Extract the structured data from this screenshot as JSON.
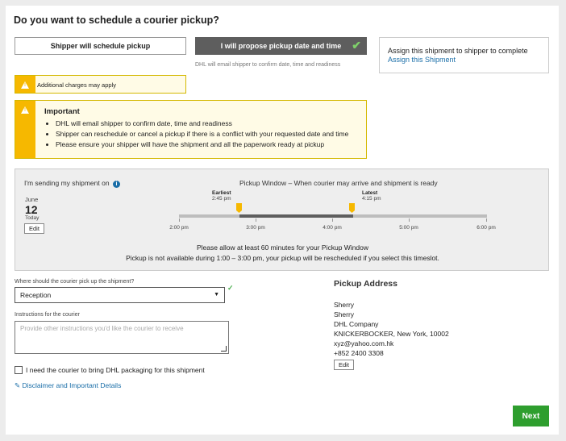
{
  "title": "Do you want to schedule a courier pickup?",
  "options": {
    "shipper": "Shipper will schedule pickup",
    "propose": "I will propose pickup date and time",
    "check": "✔",
    "helper": "DHL will email shipper to confirm date, time and readiness"
  },
  "assign": {
    "text": "Assign this shipment to shipper to complete",
    "link": "Assign this Shipment"
  },
  "charges": "Additional charges may apply",
  "important": {
    "title": "Important",
    "items": [
      "DHL will email shipper to confirm date, time and readiness",
      "Shipper can reschedule or cancel a pickup if there is a conflict with your requested date and time",
      "Please ensure your shipper will have the shipment and all the paperwork ready at pickup"
    ]
  },
  "schedule": {
    "sending_label": "I'm sending my shipment on",
    "month": "June",
    "day": "12",
    "today": "Today",
    "edit": "Edit",
    "window_title": "Pickup Window – When courier may arrive and shipment is ready",
    "earliest_label": "Earliest",
    "earliest_time": "2:45 pm",
    "latest_label": "Latest",
    "latest_time": "4:15 pm",
    "ticks": [
      "2:00 pm",
      "3:00 pm",
      "4:00 pm",
      "5:00 pm",
      "6:00 pm"
    ],
    "note1": "Please allow at least 60 minutes for your Pickup Window",
    "note2": "Pickup is not available during 1:00 – 3:00 pm, your pickup will be rescheduled if you select this timeslot."
  },
  "form": {
    "location_label": "Where should the courier pick up the shipment?",
    "location_value": "Reception",
    "instructions_label": "Instructions for the courier",
    "instructions_placeholder": "Provide other instructions you'd like the courier to receive",
    "packaging_label": "I need the courier to bring DHL packaging for this shipment",
    "disclaimer": "Disclaimer and Important Details"
  },
  "pickup_address": {
    "title": "Pickup Address",
    "name": "Sherry",
    "contact": "Sherry",
    "company": "DHL Company",
    "address": "KNICKERBOCKER, New York, 10002",
    "email": "xyz@yahoo.com.hk",
    "phone": "+852 2400 3308",
    "edit": "Edit"
  },
  "next": "Next",
  "colors": {
    "dhl_yellow": "#f6b800",
    "link": "#1a6ea8",
    "next_green": "#2e9e2e"
  }
}
